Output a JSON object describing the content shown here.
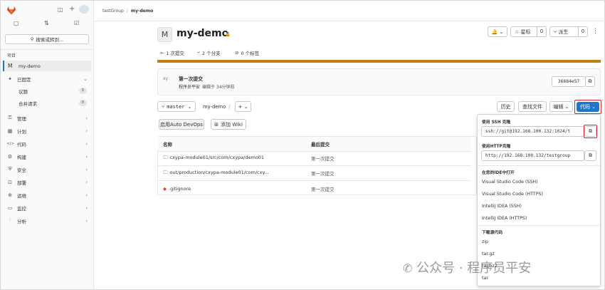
{
  "breadcrumb": {
    "group": "testGroup",
    "sep": "/",
    "project": "my-demo"
  },
  "sidebar": {
    "search_label": "搜索或转到...",
    "section_label": "项目",
    "project_avatar": "M",
    "project_name": "my-demo",
    "items": [
      {
        "label": "已固定",
        "icon": "✦",
        "chevron": "⌄"
      },
      {
        "label": "议题",
        "badge": "0"
      },
      {
        "label": "合并请求",
        "badge": "0"
      },
      {
        "label": "管理",
        "icon": "⚿",
        "chevron": "›"
      },
      {
        "label": "计划",
        "icon": "▦",
        "chevron": "›"
      },
      {
        "label": "代码",
        "icon": "</>",
        "chevron": "›"
      },
      {
        "label": "构建",
        "icon": "⚙",
        "chevron": "›"
      },
      {
        "label": "安全",
        "icon": "⛨",
        "chevron": "›"
      },
      {
        "label": "部署",
        "icon": "⊡",
        "chevron": "›"
      },
      {
        "label": "运维",
        "icon": "⊕",
        "chevron": "›"
      },
      {
        "label": "监控",
        "icon": "▭",
        "chevron": "›"
      },
      {
        "label": "分析",
        "icon": "⫶",
        "chevron": "›"
      }
    ]
  },
  "project": {
    "avatar": "M",
    "name": "my-demo",
    "lock": "🔒",
    "notify": "🔔 ⌄",
    "star_label": "☆ 星标",
    "star_count": "0",
    "fork_label": "⑂ 派生",
    "fork_count": "0",
    "more": "⋮",
    "commits": "1 次提交",
    "branches": "2 个分支",
    "tags": "0 个标签"
  },
  "last_commit": {
    "avatar_text": "xy",
    "title": "第一次提交",
    "author": "程序员平安",
    "meta": "编辑于 34分钟前",
    "sha": "36884e57"
  },
  "toolbar": {
    "branch": "master",
    "path": "my-demo",
    "path_sep": "/",
    "add": "+ ⌄",
    "history": "历史",
    "find": "查找文件",
    "edit": "编辑 ⌄",
    "code": "代码 ⌄"
  },
  "actions": {
    "auto_devops": "启用Auto DevOps",
    "wiki": "添加 Wiki"
  },
  "table": {
    "headers": [
      "名称",
      "最后提交"
    ],
    "rows": [
      {
        "icon": "📁",
        "name": "cxypa-module01/src/com/cxypa/demo01",
        "commit": "第一次提交"
      },
      {
        "icon": "📁",
        "name": "out/production/cxypa-module01/com/cxy...",
        "commit": "第一次提交"
      },
      {
        "icon": "◆",
        "name": ".gitignore",
        "commit": "第一次提交"
      }
    ]
  },
  "clone": {
    "ssh_heading": "使用 SSH 克隆",
    "ssh_url": "ssh://git@192.168.100.132:1024/t",
    "http_heading": "使用HTTP克隆",
    "http_url": "http://192.168.100.132/testgroup",
    "ide_heading": "在您的IDE中打开",
    "ide_items": [
      "Visual Studio Code (SSH)",
      "Visual Studio Code (HTTPS)",
      "IntelliJ IDEA (SSH)",
      "IntelliJ IDEA (HTTPS)"
    ],
    "download_heading": "下载源代码",
    "download_items": [
      "zip",
      "tar.gz",
      "tar.bz2",
      "tar"
    ]
  },
  "watermark": {
    "text": "公众号 · 程序员平安"
  },
  "colors": {
    "accent": "#1f75cb",
    "highlight": "#d9262f",
    "progress": "#c17d10"
  }
}
